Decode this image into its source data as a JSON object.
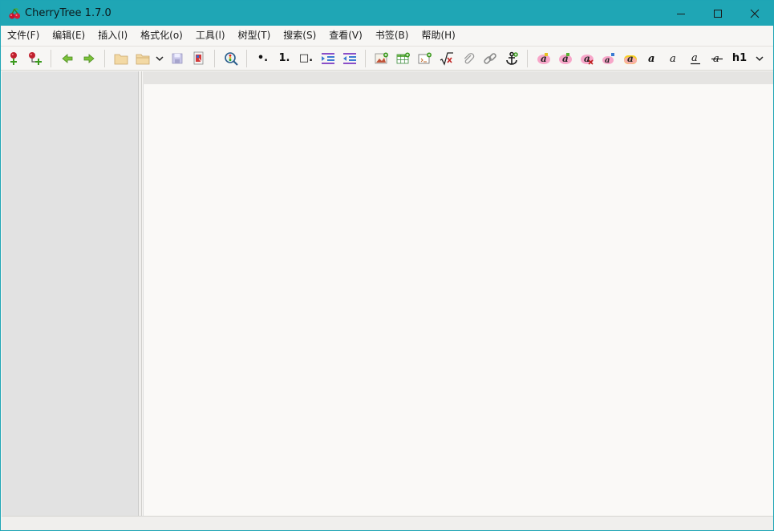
{
  "window": {
    "title": "CherryTree 1.7.0"
  },
  "menu": [
    "文件(F)",
    "编辑(E)",
    "插入(I)",
    "格式化(o)",
    "工具(l)",
    "树型(T)",
    "搜索(S)",
    "查看(V)",
    "书签(B)",
    "帮助(H)"
  ],
  "toolbar": {
    "bullet_list_label": "•.",
    "numbered_list_label": "1.",
    "todo_list_label": "□.",
    "heading_label": "h1"
  },
  "colors": {
    "titlebar": "#1fa6b5",
    "tree_bg": "#e2e2e2",
    "editor_bg": "#faf9f7"
  }
}
